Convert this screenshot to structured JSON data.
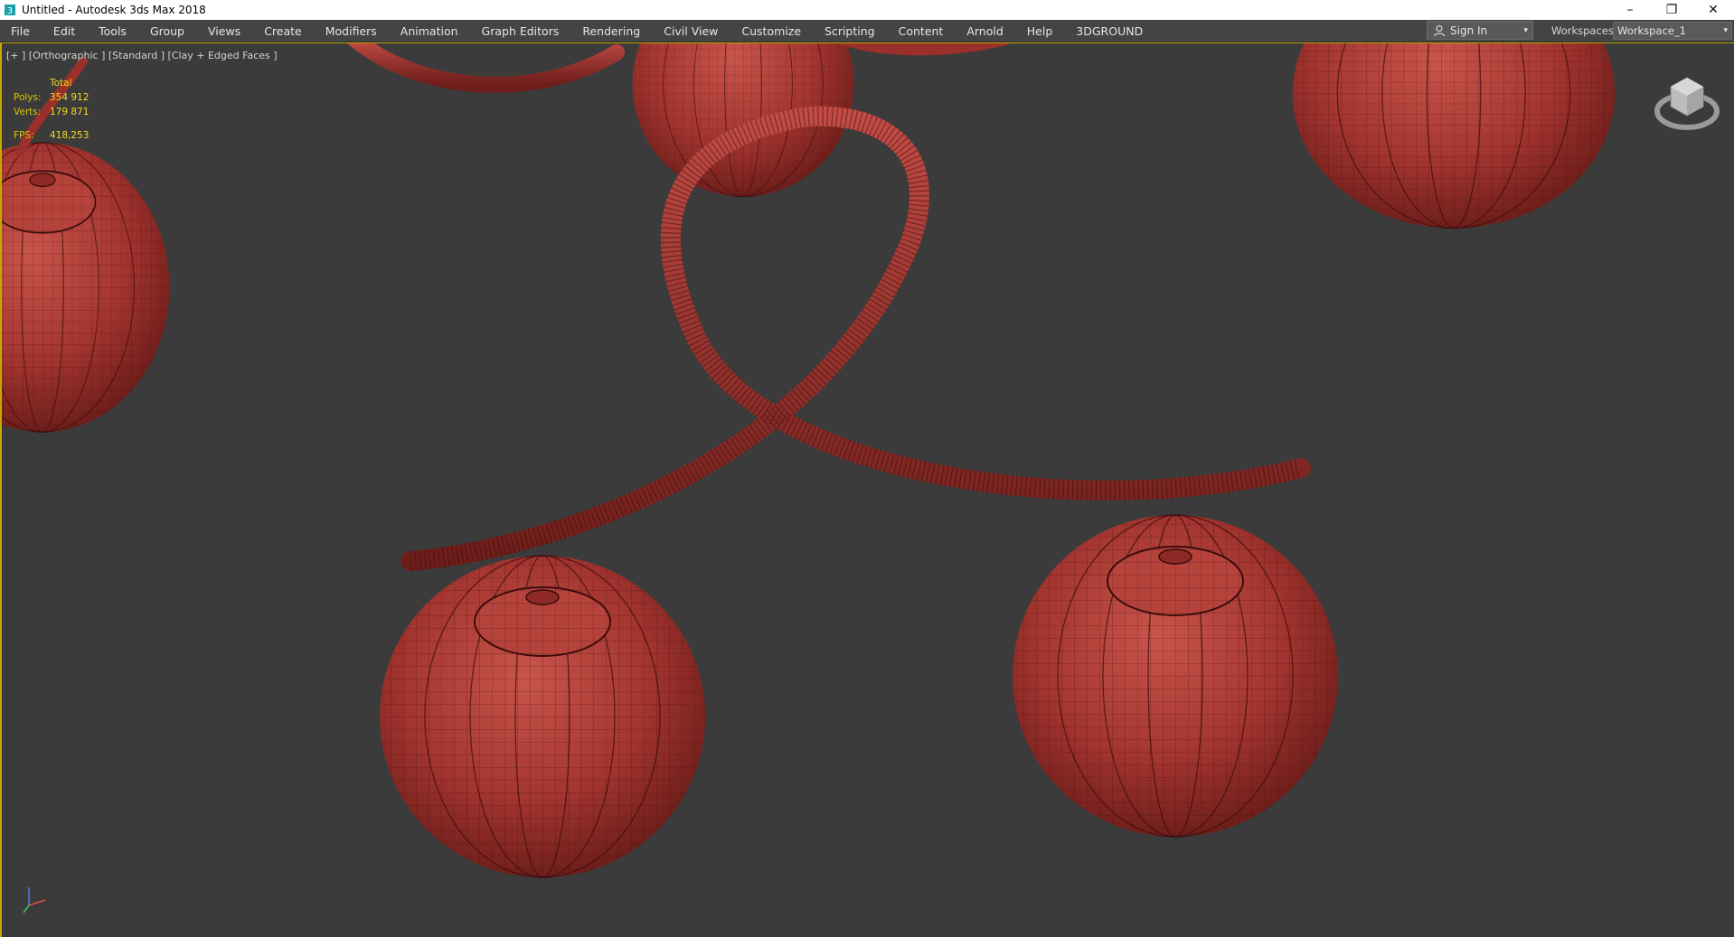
{
  "window": {
    "title": "Untitled - Autodesk 3ds Max 2018",
    "minimize": "–",
    "restore": "❐",
    "close": "✕"
  },
  "menu": [
    "File",
    "Edit",
    "Tools",
    "Group",
    "Views",
    "Create",
    "Modifiers",
    "Animation",
    "Graph Editors",
    "Rendering",
    "Civil View",
    "Customize",
    "Scripting",
    "Content",
    "Arnold",
    "Help",
    "3DGROUND"
  ],
  "signin": {
    "label": "Sign In",
    "caret": "▾"
  },
  "workspaces": {
    "label": "Workspaces:",
    "value": "Workspace_1",
    "caret": "▾"
  },
  "viewport": {
    "label": "[+ ] [Orthographic ] [Standard ] [Clay + Edged Faces ]",
    "stats": {
      "header": "Total",
      "polys_label": "Polys:",
      "polys": "354 912",
      "verts_label": "Verts:",
      "verts": "179 871",
      "fps_label": "FPS:",
      "fps": "418,253"
    }
  },
  "colors": {
    "model": "#9b2f2b",
    "viewport_bg": "#3b3b3b",
    "stats": "#e8d21a",
    "active_border": "#c5a800"
  }
}
